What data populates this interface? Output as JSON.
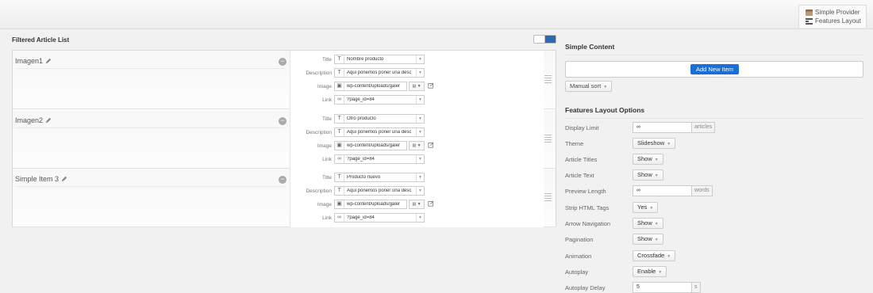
{
  "provider": {
    "name": "Simple Provider",
    "layout": "Features Layout"
  },
  "article_list": {
    "heading": "Filtered Article List",
    "field_labels": {
      "title": "Title",
      "description": "Description",
      "image": "Image",
      "link": "Link"
    },
    "items": [
      {
        "name": "Imagen1",
        "title": "Nombre producto",
        "description": "Aqui ponemos poner una desc",
        "image": "wp-content/uploads/galer",
        "link": "?page_id=84"
      },
      {
        "name": "Imagen2",
        "title": "Otro producto",
        "description": "Aqui ponemos poner una desc",
        "image": "wp-content/uploads/galer",
        "link": "?page_id=84"
      },
      {
        "name": "Simple Item 3",
        "title": "Producto nuevo",
        "description": "Aqui ponemos poner una desc",
        "image": "wp-content/uploads/galer",
        "link": "?page_id=84"
      }
    ]
  },
  "simple_content": {
    "heading": "Simple Content",
    "add_button": "Add New Item",
    "sort_button": "Manual sort"
  },
  "options": {
    "heading": "Features Layout Options",
    "display_limit": {
      "label": "Display Limit",
      "value": "∞",
      "suffix": "articles"
    },
    "theme": {
      "label": "Theme",
      "value": "Slideshow"
    },
    "article_titles": {
      "label": "Article Titles",
      "value": "Show"
    },
    "article_text": {
      "label": "Article Text",
      "value": "Show"
    },
    "preview_length": {
      "label": "Preview Length",
      "value": "∞",
      "suffix": "words"
    },
    "strip_html": {
      "label": "Strip HTML Tags",
      "value": "Yes"
    },
    "arrow_navigation": {
      "label": "Arrow Navigation",
      "value": "Show"
    },
    "pagination": {
      "label": "Pagination",
      "value": "Show"
    },
    "animation": {
      "label": "Animation",
      "value": "Crossfade"
    },
    "autoplay": {
      "label": "Autoplay",
      "value": "Enable"
    },
    "autoplay_delay": {
      "label": "Autoplay Delay",
      "value": "5",
      "suffix": "s"
    }
  },
  "colors": {
    "accent": "#1a6ed8"
  },
  "icons": [
    "provider-icon",
    "layout-icon",
    "pencil-icon",
    "remove-icon",
    "text-icon",
    "image-icon",
    "link-icon",
    "media-icon",
    "edit-icon",
    "drag-handle-icon",
    "view-toggle-icon"
  ]
}
